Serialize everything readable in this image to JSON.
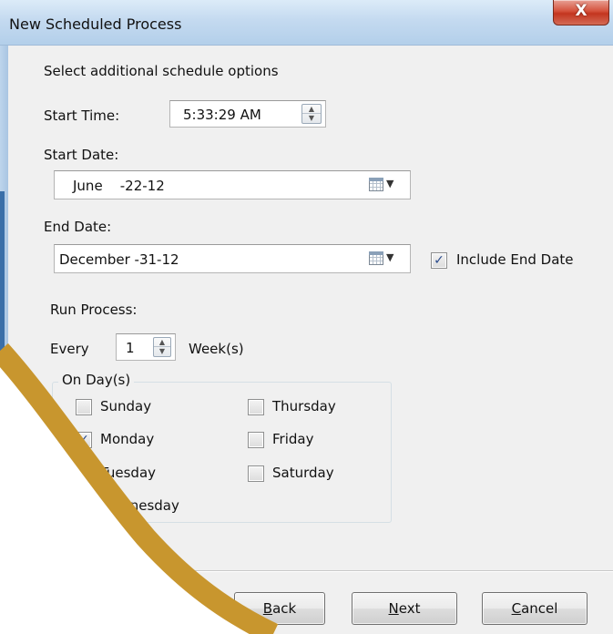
{
  "window": {
    "title": "New Scheduled Process",
    "close_glyph": "X"
  },
  "heading": "Select additional schedule options",
  "start_time": {
    "label": "Start Time:",
    "value": "5:33:29 AM"
  },
  "start_date": {
    "label": "Start Date:",
    "value": "June    -22-12"
  },
  "end_date": {
    "label": "End Date:",
    "value": "December -31-12",
    "include_label": "Include End Date",
    "include_checked": true
  },
  "run_process": {
    "label": "Run Process:",
    "every_label": "Every",
    "interval": "1",
    "unit": "Week(s)"
  },
  "days": {
    "legend": "On Day(s)",
    "items": [
      {
        "label": "Sunday",
        "checked": false
      },
      {
        "label": "Monday",
        "checked": true
      },
      {
        "label": "Tuesday",
        "checked": false
      },
      {
        "label": "Wednesday",
        "checked": false
      },
      {
        "label": "Thursday",
        "checked": false
      },
      {
        "label": "Friday",
        "checked": false
      },
      {
        "label": "Saturday",
        "checked": false
      }
    ]
  },
  "buttons": {
    "back": {
      "mnemonic": "B",
      "rest": "ack"
    },
    "next": {
      "mnemonic": "N",
      "rest": "ext"
    },
    "cancel": {
      "mnemonic": "C",
      "rest": "ancel"
    }
  },
  "icons": [
    "close-icon",
    "spin-up-icon",
    "spin-down-icon",
    "calendar-icon",
    "dropdown-arrow-icon",
    "checkmark-icon"
  ],
  "colors": {
    "decor_arc": "#c8962e",
    "titlebar": "#c4daf0",
    "close": "#c3351f",
    "check": "#2a4a8c"
  }
}
